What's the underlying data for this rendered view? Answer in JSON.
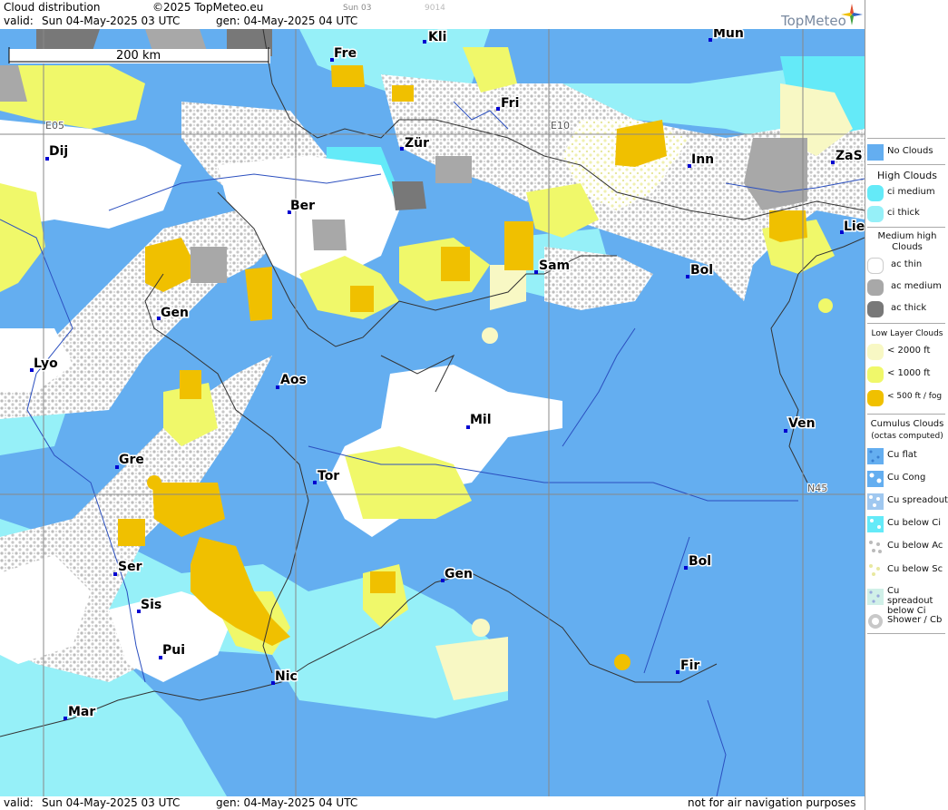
{
  "header": {
    "title": "Cloud distribution",
    "copyright": "©2025 TopMeteo.eu",
    "small_time": "Sun 03",
    "small_code": "9014",
    "valid_label": "valid:",
    "valid_date": "Sun  04-May-2025  03 UTC",
    "gen_label": "gen: 04-May-2025 04 UTC",
    "logo": "TopMeteo"
  },
  "map": {
    "scale_label": "200 km",
    "grid_labels": [
      "E05",
      "E10",
      "N45"
    ],
    "cities": [
      "Kli",
      "Mün",
      "Fre",
      "Fri",
      "Dij",
      "Zür",
      "Inn",
      "ZaS",
      "Ber",
      "Lie",
      "Sam",
      "Bol",
      "Gen",
      "Lyo",
      "Aos",
      "Mil",
      "Ven",
      "Gre",
      "Tor",
      "Ser",
      "Gen",
      "Bol",
      "Sis",
      "Pui",
      "Nic",
      "Fir",
      "Mar"
    ]
  },
  "footer": {
    "valid_label": "valid:",
    "valid_date": "Sun  04-May-2025  03 UTC",
    "gen_label": "gen: 04-May-2025 04 UTC",
    "disclaimer": "not for air navigation purposes"
  },
  "legend": {
    "no_clouds": "No Clouds",
    "high_title": "High Clouds",
    "high": [
      "ci medium",
      "ci thick"
    ],
    "medium_title": "Medium high Clouds",
    "medium": [
      "ac thin",
      "ac medium",
      "ac thick"
    ],
    "low_title": "Low Layer Clouds",
    "low": [
      "< 2000 ft",
      "< 1000 ft",
      "< 500 ft / fog"
    ],
    "cumulus_title": "Cumulus Clouds",
    "cumulus_subtitle": "(octas computed)",
    "cumulus": [
      "Cu flat",
      "Cu Cong",
      "Cu spreadout",
      "Cu below Ci",
      "Cu below Ac",
      "Cu below Sc",
      "Cu spreadout below Ci",
      "Shower / Cb"
    ]
  },
  "colors": {
    "no_clouds": "#64aef0",
    "ci_medium": "#64eaf8",
    "ci_thick": "#96f0f8",
    "ac_thin": "#ffffff",
    "ac_medium": "#a8a8a8",
    "ac_thick": "#787878",
    "low_2000": "#f8f8c4",
    "low_1000": "#f0f86a",
    "low_500": "#f0c000",
    "cu_below_ac": "#d4d4d4"
  }
}
